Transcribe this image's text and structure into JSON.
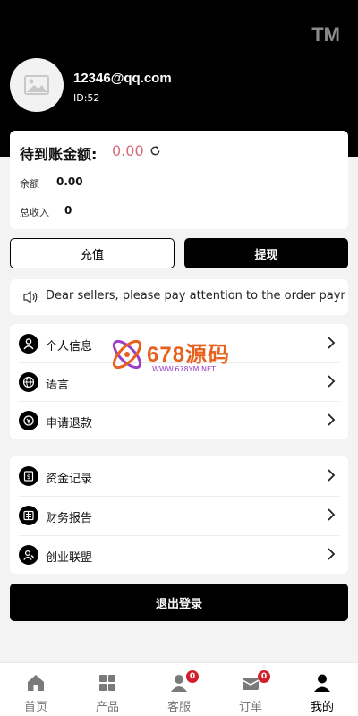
{
  "header": {
    "logo_text": "TM",
    "email": "12346@qq.com",
    "user_id": "ID:52"
  },
  "balance": {
    "pending_label": "待到账金额:",
    "pending_value": "0.00",
    "rows": [
      {
        "label": "余额",
        "value": "0.00"
      },
      {
        "label": "总收入",
        "value": "0"
      }
    ]
  },
  "actions": {
    "recharge": "充值",
    "withdraw": "提现"
  },
  "notice": {
    "text": "Dear sellers, please pay attention to the order payme"
  },
  "menu_group_1": [
    {
      "label": "个人信息",
      "icon": "person-icon"
    },
    {
      "label": "语言",
      "icon": "globe-icon"
    },
    {
      "label": "申请退款",
      "icon": "refund-icon"
    }
  ],
  "menu_group_2": [
    {
      "label": "资金记录",
      "icon": "money-record-icon"
    },
    {
      "label": "财务报告",
      "icon": "report-icon"
    },
    {
      "label": "创业联盟",
      "icon": "alliance-icon"
    }
  ],
  "logout": "退出登录",
  "watermark": {
    "title": "678源码",
    "url": "WWW.678YM.NET"
  },
  "tabs": [
    {
      "label": "首页",
      "icon": "home-icon",
      "badge": ""
    },
    {
      "label": "产品",
      "icon": "grid-icon",
      "badge": ""
    },
    {
      "label": "客服",
      "icon": "support-icon",
      "badge": "0"
    },
    {
      "label": "订单",
      "icon": "orders-icon",
      "badge": "0"
    },
    {
      "label": "我的",
      "icon": "user-icon",
      "badge": ""
    }
  ],
  "active_tab": "我的",
  "colors": {
    "pending_value": "#d26b7a",
    "badge": "#d0202d",
    "accent": "#000000"
  }
}
